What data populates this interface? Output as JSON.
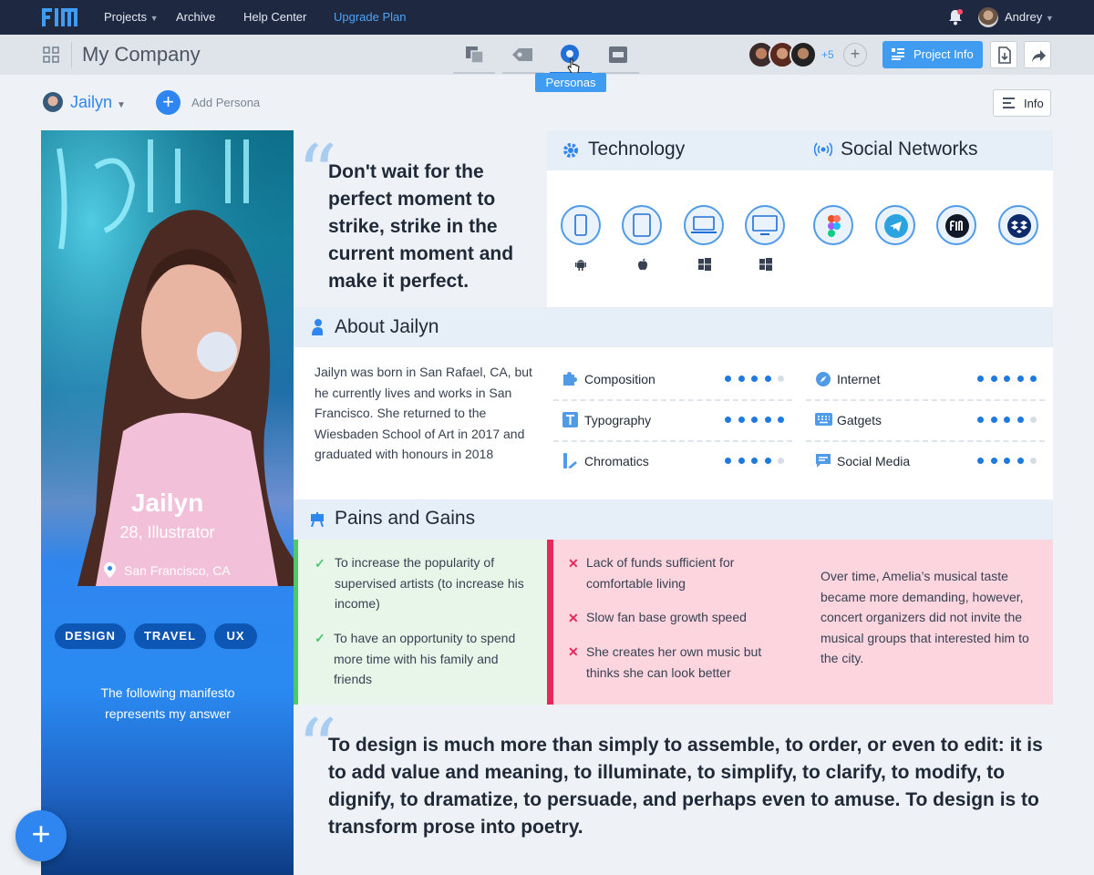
{
  "topnav": {
    "projects": "Projects",
    "archive": "Archive",
    "help": "Help Center",
    "upgrade": "Upgrade Plan",
    "user": "Andrey"
  },
  "subbar": {
    "company": "My Company",
    "tooltip": "Personas",
    "collab_more": "+5",
    "project_info": "Project Info"
  },
  "persona_bar": {
    "selected": "Jailyn",
    "add": "Add Persona",
    "info": "Info"
  },
  "profile": {
    "name": "Jailyn",
    "subtitle": "28, Illustrator",
    "location": "San Francisco, CA",
    "tags": [
      "DESIGN",
      "TRAVEL",
      "UX"
    ],
    "manifesto": "The following manifesto represents my answer"
  },
  "quote_top": "Don't wait for the perfect moment to strike, strike in the current moment and make it perfect.",
  "technology": {
    "title": "Technology"
  },
  "social": {
    "title": "Social Networks"
  },
  "about": {
    "title": "About Jailyn",
    "text": "Jailyn was born in San Rafael, CA, but he currently lives and works in San Francisco. She returned to the Wiesbaden School of Art in 2017 and graduated with honours in 2018"
  },
  "skills_left": [
    {
      "label": "Composition",
      "level": 4,
      "max": 5
    },
    {
      "label": "Typography",
      "level": 5,
      "max": 5
    },
    {
      "label": "Chromatics",
      "level": 4,
      "max": 5
    }
  ],
  "skills_right": [
    {
      "label": "Internet",
      "level": 5,
      "max": 5
    },
    {
      "label": "Gatgets",
      "level": 4,
      "max": 5
    },
    {
      "label": "Social Media",
      "level": 4,
      "max": 5
    }
  ],
  "pains_gains": {
    "title": "Pains and Gains",
    "gains": [
      "To increase the popularity of supervised artists (to increase his income)",
      "To have an opportunity to spend more time with his family and friends"
    ],
    "pains": [
      "Lack of funds sufficient for comfortable living",
      "Slow fan base growth speed",
      "She creates her own music but thinks she can look better"
    ],
    "note": "Over time, Amelia’s musical taste became more demanding, however, concert organizers did not invite the musical groups that interested him to the city."
  },
  "quote_bottom": "To design is much more than simply to assemble, to order, or even to edit: it is to add value and meaning, to illuminate, to simplify, to clarify, to modify, to dignify, to dramatize, to persuade, and perhaps even to amuse. To design is to transform prose into poetry.",
  "colors": {
    "accent": "#2f86f0",
    "topbar": "#1e2840",
    "gain_bg": "#e8f6ea",
    "gain_border": "#4cc96b",
    "pain_bg": "#fdd5df",
    "pain_border": "#e8285a"
  }
}
